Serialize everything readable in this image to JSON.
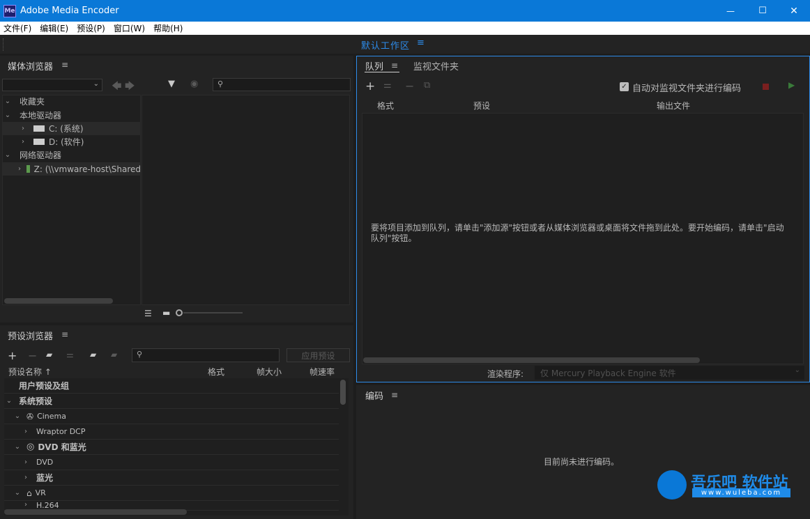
{
  "window": {
    "title": "Adobe Media Encoder",
    "icon_text": "Me",
    "minimize": "—",
    "maximize": "☐",
    "close": "✕"
  },
  "menu": [
    "文件(F)",
    "编辑(E)",
    "预设(P)",
    "窗口(W)",
    "帮助(H)"
  ],
  "workspace": {
    "label": "默认工作区",
    "menu_icon": "≡"
  },
  "media_browser": {
    "title": "媒体浏览器",
    "tree": [
      {
        "label": "收藏夹",
        "expanded": true
      },
      {
        "label": "本地驱动器",
        "expanded": true
      },
      {
        "label": "C: (系统)"
      },
      {
        "label": "D: (软件)"
      },
      {
        "label": "网络驱动器",
        "expanded": true
      },
      {
        "label": "Z: (\\\\vmware-host\\Shared"
      }
    ]
  },
  "preset_browser": {
    "title": "预设浏览器",
    "apply_button": "应用预设",
    "columns": [
      "预设名称 ↑",
      "格式",
      "帧大小",
      "帧速率"
    ],
    "rows": [
      {
        "label": "用户预设及组"
      },
      {
        "label": "系统预设"
      },
      {
        "label": "Cinema"
      },
      {
        "label": "Wraptor DCP"
      },
      {
        "label": "DVD 和蓝光"
      },
      {
        "label": "DVD"
      },
      {
        "label": "蓝光"
      },
      {
        "label": "VR"
      },
      {
        "label": "H.264"
      }
    ]
  },
  "queue": {
    "tab_queue": "队列",
    "tab_watch": "监视文件夹",
    "auto_encode_label": "自动对监视文件夹进行编码",
    "columns": [
      "格式",
      "预设",
      "输出文件"
    ],
    "empty_message": "要将项目添加到队列，请单击\"添加源\"按钮或者从媒体浏览器或桌面将文件拖到此处。要开始编码，请单击\"启动队列\"按钮。",
    "renderer_label": "渲染程序:",
    "renderer_value": "仅 Mercury Playback Engine 软件"
  },
  "encoding": {
    "title": "编码",
    "status": "目前尚未进行编码。"
  },
  "watermark": {
    "name": "吾乐吧 软件站",
    "url": "www.wuleba.com"
  },
  "colors": {
    "accent": "#2d8ceb",
    "titlebar": "#0a78d7",
    "panel": "#232323"
  }
}
